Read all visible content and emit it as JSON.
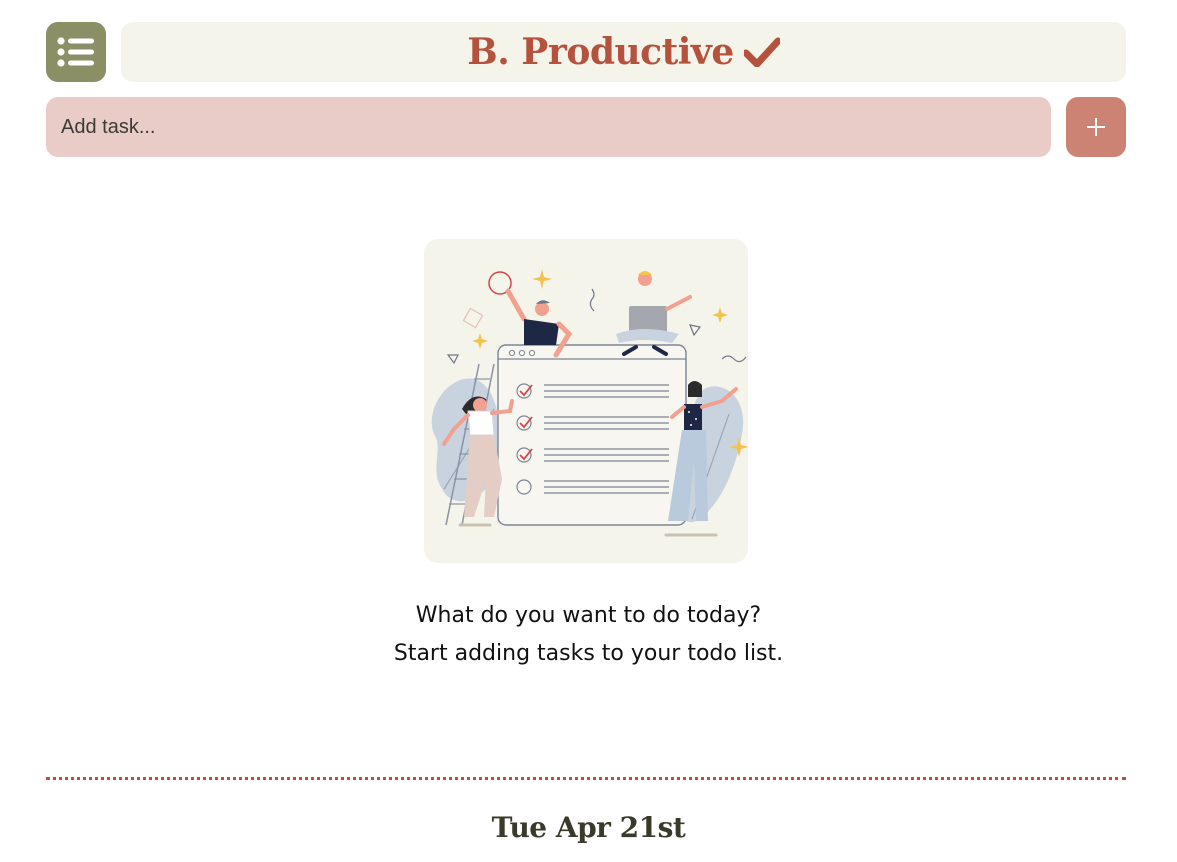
{
  "header": {
    "menu_icon": "list-icon",
    "title": "B. Productive",
    "title_icon": "checkmark-icon",
    "colors": {
      "menu_bg": "#8b8f66",
      "title_bg": "#f5f4ea",
      "title_text": "#b5523e"
    }
  },
  "task_input": {
    "placeholder": "Add task...",
    "value": "",
    "bg_color": "#e9ccc8"
  },
  "add_button": {
    "icon": "plus-icon",
    "bg_color": "#cc8373"
  },
  "empty_state": {
    "illustration": "people-checklist-illustration",
    "line1": "What do you want to do today?",
    "line2": "Start adding tasks to your todo list."
  },
  "footer": {
    "date": "Tue Apr 21st",
    "divider_color": "#b5523e"
  }
}
